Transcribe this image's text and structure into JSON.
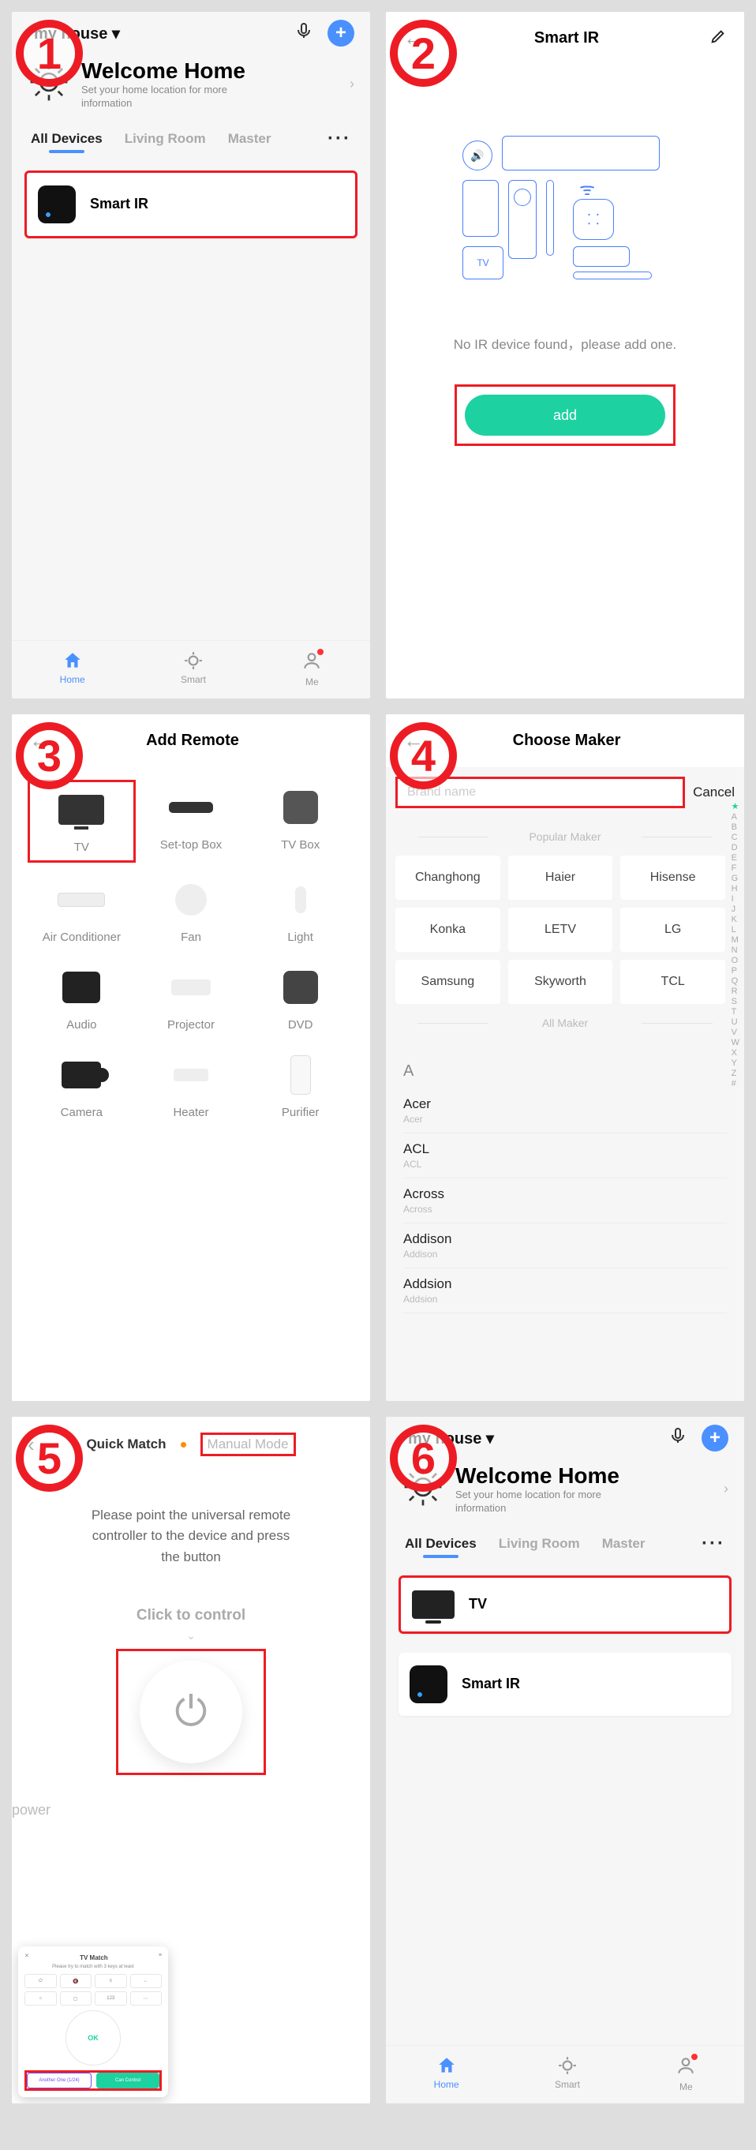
{
  "s1": {
    "house": "my house ▾",
    "welcome_title": "Welcome Home",
    "welcome_sub": "Set your home location for more information",
    "tabs": [
      "All Devices",
      "Living Room",
      "Master"
    ],
    "device": "Smart IR",
    "nav": {
      "home": "Home",
      "smart": "Smart",
      "me": "Me"
    }
  },
  "s2": {
    "title": "Smart IR",
    "no_device": "No IR device found，please add one.",
    "add": "add",
    "tv_label": "TV"
  },
  "s3": {
    "title": "Add Remote",
    "items": [
      "TV",
      "Set-top Box",
      "TV Box",
      "Air Conditioner",
      "Fan",
      "Light",
      "Audio",
      "Projector",
      "DVD",
      "Camera",
      "Heater",
      "Purifier"
    ]
  },
  "s4": {
    "title": "Choose Maker",
    "placeholder": "Brand name",
    "cancel": "Cancel",
    "popular_label": "Popular Maker",
    "all_label": "All Maker",
    "popular": [
      "Changhong",
      "Haier",
      "Hisense",
      "Konka",
      "LETV",
      "LG",
      "Samsung",
      "Skyworth",
      "TCL"
    ],
    "letters": [
      "★",
      "A",
      "B",
      "C",
      "D",
      "E",
      "F",
      "G",
      "H",
      "I",
      "J",
      "K",
      "L",
      "M",
      "N",
      "O",
      "P",
      "Q",
      "R",
      "S",
      "T",
      "U",
      "V",
      "W",
      "X",
      "Y",
      "Z",
      "#"
    ],
    "section_letter": "A",
    "all": [
      {
        "n": "Acer",
        "s": "Acer"
      },
      {
        "n": "ACL",
        "s": "ACL"
      },
      {
        "n": "Across",
        "s": "Across"
      },
      {
        "n": "Addison",
        "s": "Addison"
      },
      {
        "n": "Addsion",
        "s": "Addsion"
      }
    ]
  },
  "s5": {
    "quick": "Quick Match",
    "manual": "Manual Mode",
    "instr": "Please point the universal remote controller to the device and press the button",
    "click": "Click to control",
    "power": "power",
    "popup": {
      "title": "TV Match",
      "sub": "Please try to match with 3 keys at least",
      "ok": "OK",
      "b1": "Another One (1/24)",
      "b2": "Can Control"
    }
  },
  "s6": {
    "house": "my house ▾",
    "welcome_title": "Welcome Home",
    "welcome_sub": "Set your home location for more information",
    "tabs": [
      "All Devices",
      "Living Room",
      "Master"
    ],
    "device_tv": "TV",
    "device_ir": "Smart IR",
    "nav": {
      "home": "Home",
      "smart": "Smart",
      "me": "Me"
    }
  },
  "steps": [
    "1",
    "2",
    "3",
    "4",
    "5",
    "6"
  ]
}
